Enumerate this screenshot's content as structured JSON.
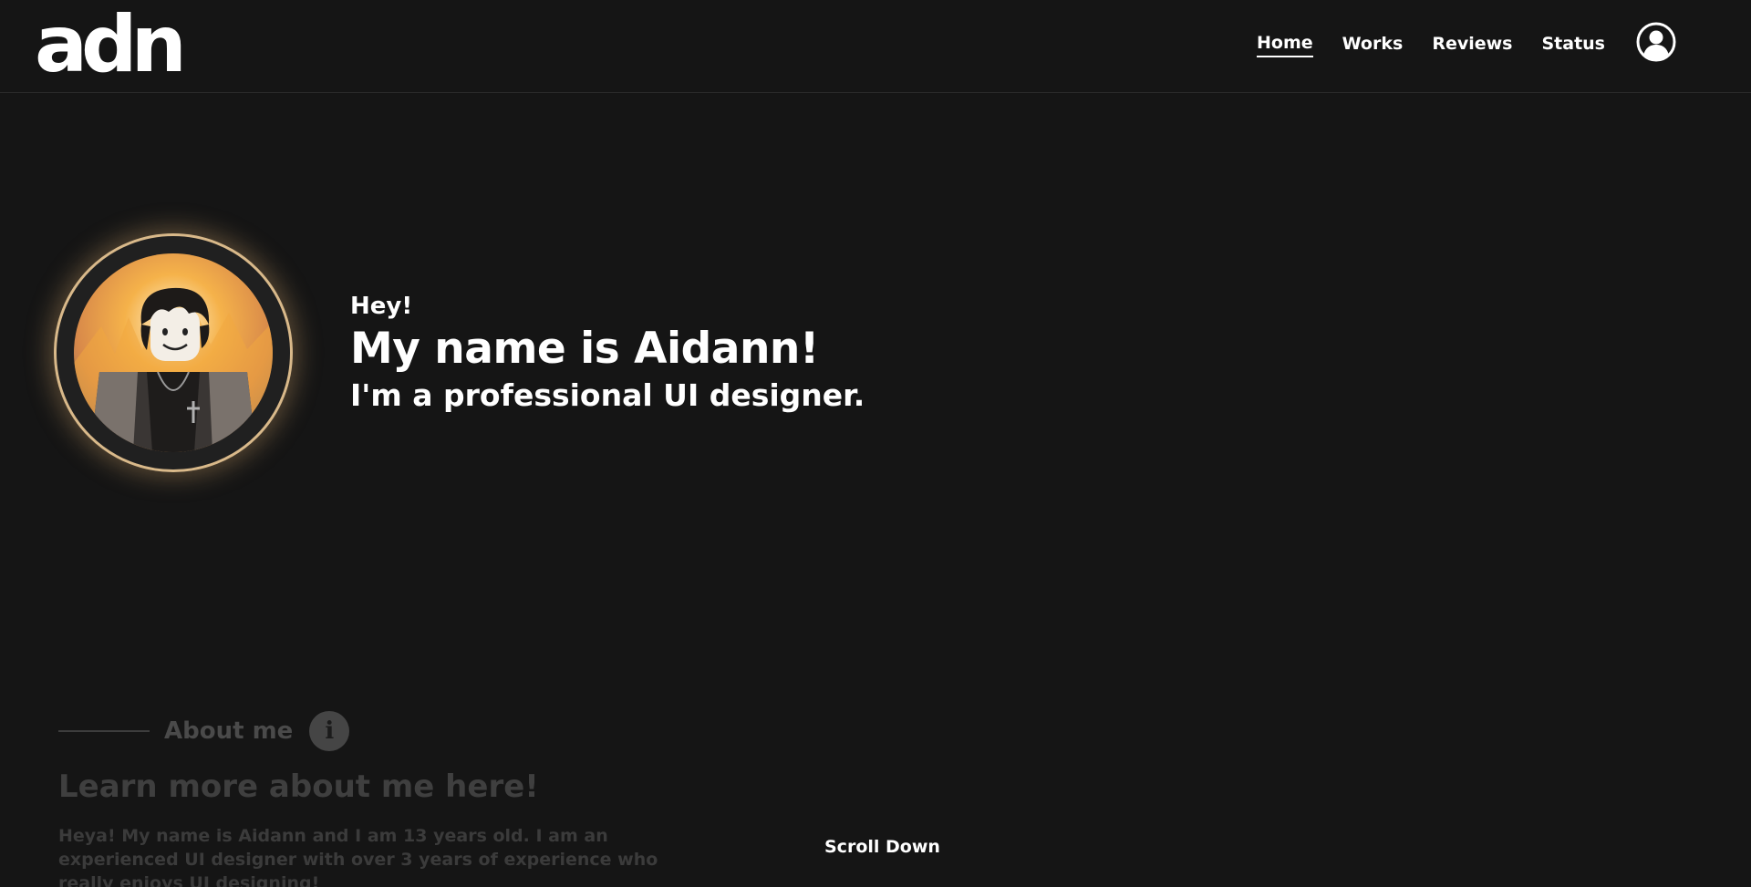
{
  "header": {
    "logo_text": "adn",
    "nav": [
      {
        "label": "Home",
        "active": true
      },
      {
        "label": "Works",
        "active": false
      },
      {
        "label": "Reviews",
        "active": false
      },
      {
        "label": "Status",
        "active": false
      }
    ],
    "user_icon": "user-circle-icon"
  },
  "hero": {
    "greeting": "Hey!",
    "name_line": "My name is Aidann!",
    "role_line": "I'm a professional UI designer.",
    "avatar_ring_color": "#d9b98a"
  },
  "about": {
    "title": "About me",
    "icon": "info-icon",
    "info_glyph": "i",
    "subtitle": "Learn more about me here!",
    "body": "Heya! My name is Aidann and I am 13 years old. I am an experienced UI designer with over 3 years of experience who really enjoys UI designing!"
  },
  "scroll_label": "Scroll Down",
  "colors": {
    "background": "#151515",
    "text": "#ffffff",
    "faded_text": "#4a4a4a"
  }
}
